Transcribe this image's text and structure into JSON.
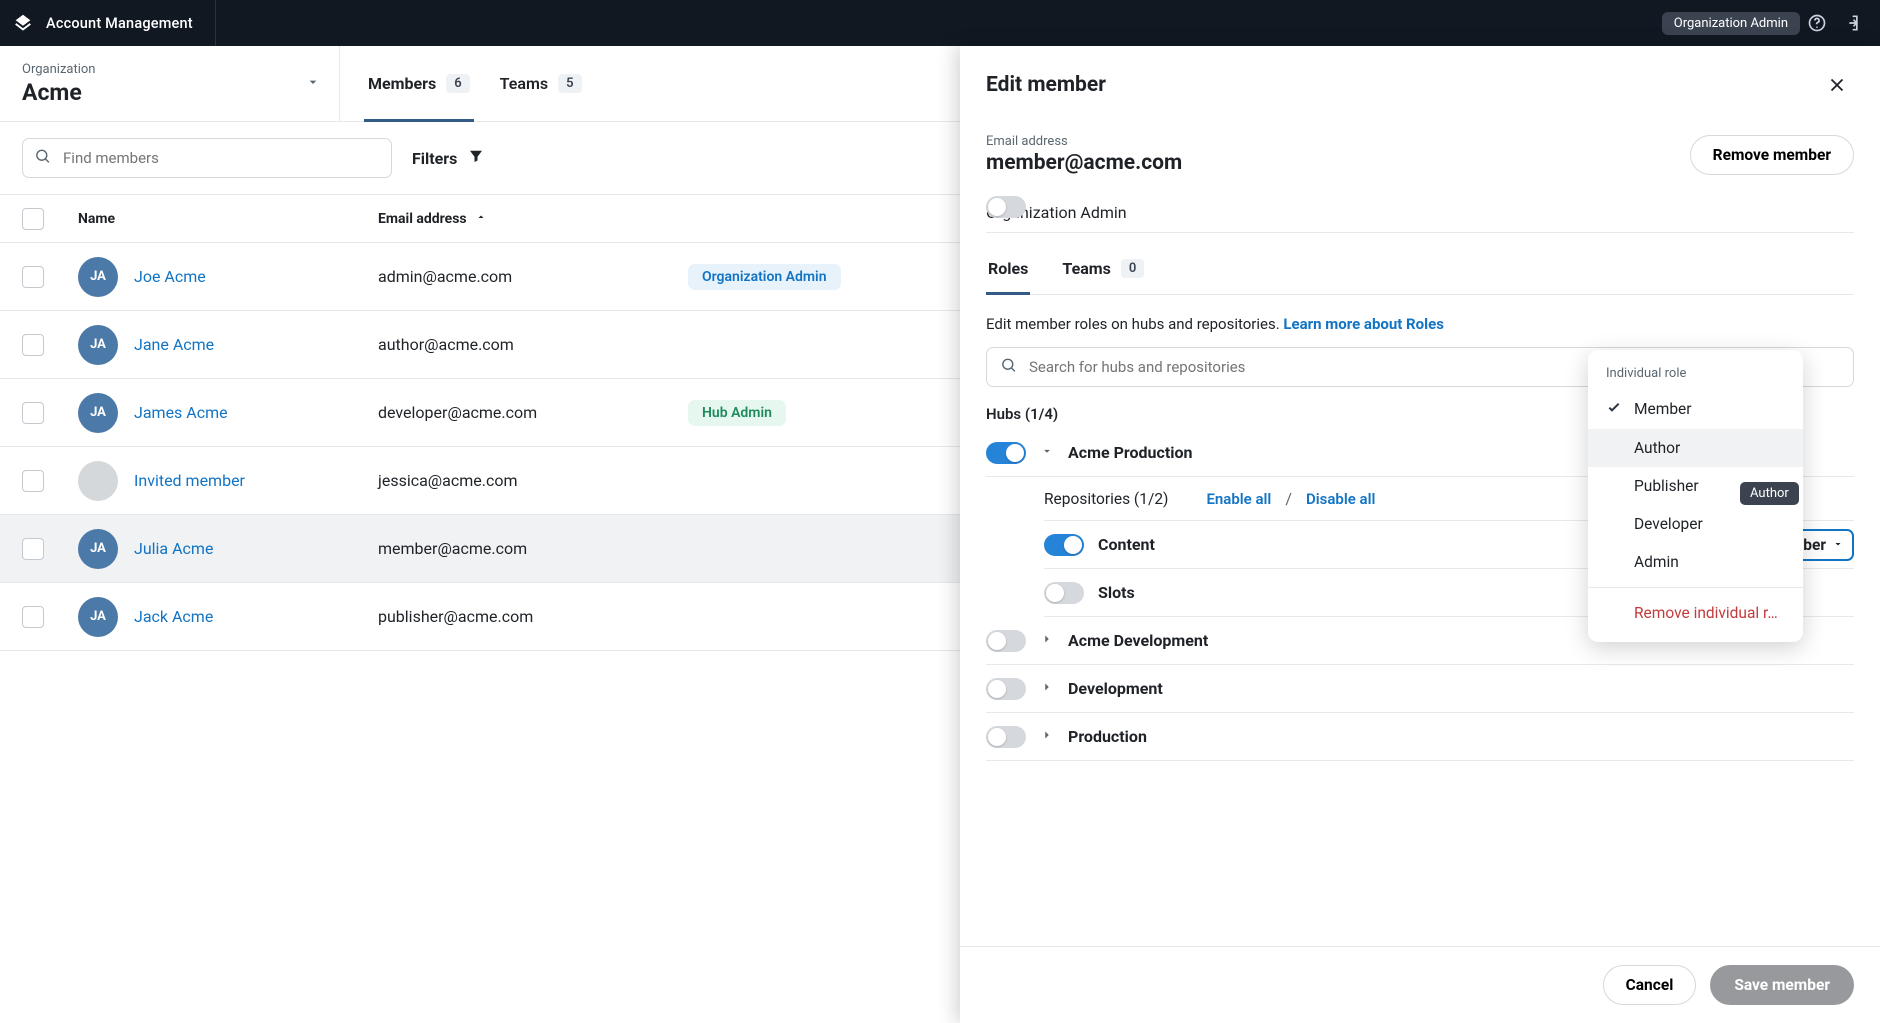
{
  "appbar": {
    "title": "Account Management",
    "role_chip": "Organization Admin"
  },
  "org": {
    "kicker": "Organization",
    "name": "Acme"
  },
  "tabs": {
    "members": {
      "label": "Members",
      "count": "6"
    },
    "teams": {
      "label": "Teams",
      "count": "5"
    }
  },
  "toolbar": {
    "search_placeholder": "Find members",
    "filters_label": "Filters"
  },
  "columns": {
    "name": "Name",
    "email": "Email address"
  },
  "members": [
    {
      "initials": "JA",
      "name": "Joe Acme",
      "email": "admin@acme.com",
      "badge": "Organization Admin",
      "badge_style": "blue"
    },
    {
      "initials": "JA",
      "name": "Jane Acme",
      "email": "author@acme.com",
      "badge": "",
      "badge_style": ""
    },
    {
      "initials": "JA",
      "name": "James Acme",
      "email": "developer@acme.com",
      "badge": "Hub Admin",
      "badge_style": "green"
    },
    {
      "initials": "",
      "name": "Invited member",
      "email": "jessica@acme.com",
      "badge": "",
      "badge_style": "",
      "gray": true
    },
    {
      "initials": "JA",
      "name": "Julia Acme",
      "email": "member@acme.com",
      "badge": "",
      "badge_style": "",
      "highlight": true
    },
    {
      "initials": "JA",
      "name": "Jack Acme",
      "email": "publisher@acme.com",
      "badge": "",
      "badge_style": ""
    }
  ],
  "panel": {
    "title": "Edit member",
    "email_kicker": "Email address",
    "email_value": "member@acme.com",
    "remove_btn": "Remove member",
    "org_admin_label": "Organization Admin",
    "org_admin_on": false,
    "tabs": {
      "roles": "Roles",
      "teams": "Teams",
      "teams_count": "0"
    },
    "hint_prefix": "Edit member roles on hubs and repositories. ",
    "hint_link": "Learn more about Roles",
    "search_placeholder": "Search for hubs and repositories",
    "hubs_label": "Hubs (1/4)",
    "hubs": [
      {
        "name": "Acme Production",
        "on": true,
        "expanded": true
      },
      {
        "name": "Acme Development",
        "on": false,
        "expanded": false
      },
      {
        "name": "Development",
        "on": false,
        "expanded": false
      },
      {
        "name": "Production",
        "on": false,
        "expanded": false
      }
    ],
    "repos_label": "Repositories (1/2)",
    "enable_all": "Enable all",
    "disable_all": "Disable all",
    "slash": "/",
    "repos": [
      {
        "name": "Content",
        "on": true,
        "role": "Member"
      },
      {
        "name": "Slots",
        "on": false,
        "role": ""
      }
    ],
    "footer": {
      "cancel": "Cancel",
      "save": "Save member"
    }
  },
  "dropdown": {
    "title": "Individual role",
    "items": [
      {
        "label": "Member",
        "selected": true
      },
      {
        "label": "Author",
        "selected": false,
        "hover": true
      },
      {
        "label": "Publisher",
        "selected": false
      },
      {
        "label": "Developer",
        "selected": false
      },
      {
        "label": "Admin",
        "selected": false
      }
    ],
    "remove": "Remove individual r…",
    "tooltip": "Author"
  }
}
